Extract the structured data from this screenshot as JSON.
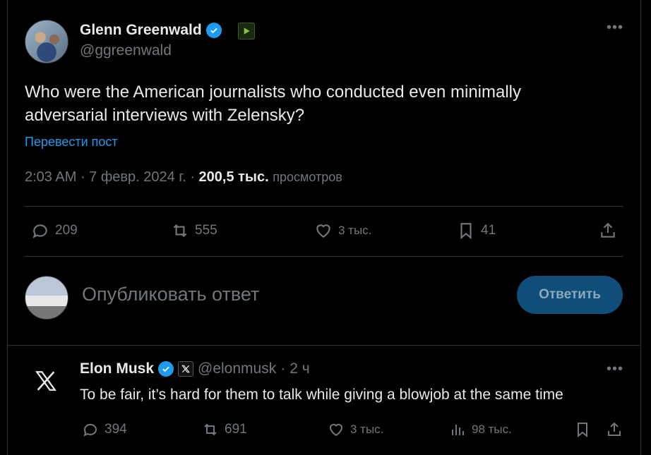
{
  "tweet": {
    "author_name": "Glenn Greenwald",
    "author_handle": "@ggreenwald",
    "text": "Who were the American journalists who conducted even minimally adversarial interviews with Zelensky?",
    "translate_label": "Перевести пост",
    "time": "2:03 AM",
    "date": "7 февр. 2024 г.",
    "views_count": "200,5 тыс.",
    "views_label": "просмотров",
    "actions": {
      "replies": "209",
      "reposts": "555",
      "likes": "3 тыс.",
      "bookmarks": "41"
    }
  },
  "composer": {
    "placeholder": "Опубликовать ответ",
    "button_label": "Ответить"
  },
  "reply": {
    "author_name": "Elon Musk",
    "author_handle": "@elonmusk",
    "age": "2 ч",
    "text": "To be fair, it’s hard for them to talk while giving a blowjob at the same time",
    "actions": {
      "replies": "394",
      "reposts": "691",
      "likes": "3 тыс.",
      "views": "98 тыс."
    }
  },
  "colors": {
    "background": "#000000",
    "text": "#e7e9ea",
    "muted": "#71767b",
    "accent": "#1d9bf0",
    "divider": "#2f3336"
  }
}
